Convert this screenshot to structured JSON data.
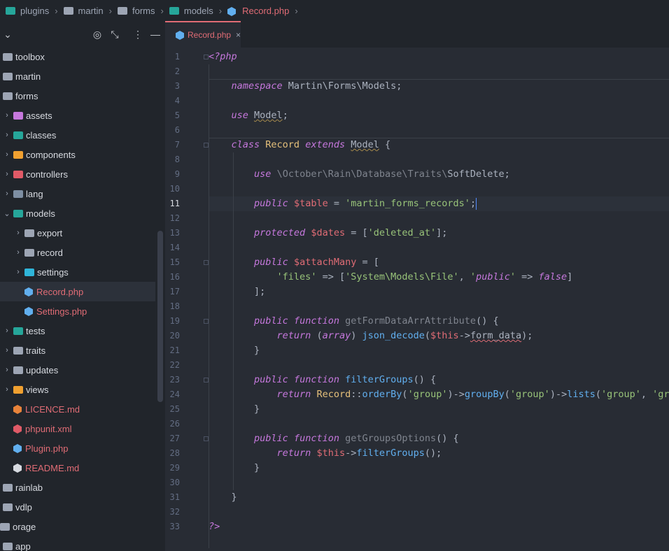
{
  "breadcrumb": [
    "plugins",
    "martin",
    "forms",
    "models",
    "Record.php"
  ],
  "tab": {
    "label": "Record.php",
    "close": "×"
  },
  "tree": [
    {
      "label": "toolbox",
      "indent": 0,
      "kind": "plain",
      "color": "#d7dae0"
    },
    {
      "label": "martin",
      "indent": 0,
      "kind": "plain",
      "color": "#d7dae0"
    },
    {
      "label": "forms",
      "indent": 0,
      "kind": "plain",
      "color": "#d7dae0"
    },
    {
      "label": "assets",
      "indent": 1,
      "kind": "folder",
      "icon": "#c678dd",
      "color": "#d7dae0"
    },
    {
      "label": "classes",
      "indent": 1,
      "kind": "folder",
      "icon": "#26a69a",
      "color": "#d7dae0"
    },
    {
      "label": "components",
      "indent": 1,
      "kind": "folder",
      "icon": "#f0a030",
      "color": "#d7dae0"
    },
    {
      "label": "controllers",
      "indent": 1,
      "kind": "folder",
      "icon": "#e05a67",
      "color": "#d7dae0"
    },
    {
      "label": "lang",
      "indent": 1,
      "kind": "folder",
      "icon": "#7e8fa3",
      "color": "#d7dae0"
    },
    {
      "label": "models",
      "indent": 1,
      "kind": "folder-open",
      "icon": "#26a69a",
      "color": "#d7dae0"
    },
    {
      "label": "export",
      "indent": 2,
      "kind": "folder",
      "icon": "#9da5b4",
      "color": "#d7dae0"
    },
    {
      "label": "record",
      "indent": 2,
      "kind": "folder",
      "icon": "#9da5b4",
      "color": "#d7dae0"
    },
    {
      "label": "settings",
      "indent": 2,
      "kind": "folder",
      "icon": "#2fb5d9",
      "color": "#d7dae0"
    },
    {
      "label": "Record.php",
      "indent": 2,
      "kind": "file",
      "icon": "#61afef",
      "color": "#e06c75",
      "selected": true
    },
    {
      "label": "Settings.php",
      "indent": 2,
      "kind": "file",
      "icon": "#61afef",
      "color": "#e06c75"
    },
    {
      "label": "tests",
      "indent": 1,
      "kind": "folder",
      "icon": "#26a69a",
      "color": "#d7dae0"
    },
    {
      "label": "traits",
      "indent": 1,
      "kind": "folder",
      "icon": "#9da5b4",
      "color": "#d7dae0"
    },
    {
      "label": "updates",
      "indent": 1,
      "kind": "folder",
      "icon": "#9da5b4",
      "color": "#d7dae0"
    },
    {
      "label": "views",
      "indent": 1,
      "kind": "folder",
      "icon": "#f0a030",
      "color": "#d7dae0"
    },
    {
      "label": "LICENCE.md",
      "indent": 1,
      "kind": "file",
      "icon": "#e8833a",
      "color": "#e06c75"
    },
    {
      "label": "phpunit.xml",
      "indent": 1,
      "kind": "file",
      "icon": "#e05a67",
      "color": "#e06c75"
    },
    {
      "label": "Plugin.php",
      "indent": 1,
      "kind": "file",
      "icon": "#61afef",
      "color": "#e06c75"
    },
    {
      "label": "README.md",
      "indent": 1,
      "kind": "file",
      "icon": "#d7dae0",
      "color": "#e06c75"
    },
    {
      "label": "rainlab",
      "indent": 0,
      "kind": "plain",
      "color": "#d7dae0"
    },
    {
      "label": "vdlp",
      "indent": 0,
      "kind": "plain",
      "color": "#d7dae0"
    },
    {
      "label": "orage",
      "indent": -1,
      "kind": "plain",
      "color": "#d7dae0"
    },
    {
      "label": "app",
      "indent": 0,
      "kind": "plain",
      "color": "#d7dae0"
    }
  ],
  "current_line": 11,
  "fold_lines": [
    1,
    7,
    15,
    19,
    23,
    27
  ],
  "code": [
    [
      [
        "kw",
        "<?php"
      ]
    ],
    [],
    [
      [
        "t",
        "    "
      ],
      [
        "kw",
        "namespace"
      ],
      [
        "t",
        " Martin\\Forms\\Models;"
      ]
    ],
    [],
    [
      [
        "t",
        "    "
      ],
      [
        "kw",
        "use"
      ],
      [
        "t",
        " "
      ],
      [
        "wv",
        "Model"
      ],
      [
        "t",
        ";"
      ]
    ],
    [],
    [
      [
        "t",
        "    "
      ],
      [
        "kw",
        "class"
      ],
      [
        "t",
        " "
      ],
      [
        "cls",
        "Record"
      ],
      [
        "t",
        " "
      ],
      [
        "kw",
        "extends"
      ],
      [
        "t",
        " "
      ],
      [
        "wv",
        "Model"
      ],
      [
        "t",
        " {"
      ]
    ],
    [],
    [
      [
        "t",
        "        "
      ],
      [
        "kw",
        "use"
      ],
      [
        "t",
        " "
      ],
      [
        "dim",
        "\\October\\Rain\\Database\\Traits\\"
      ],
      [
        "t",
        "SoftDelete;"
      ]
    ],
    [],
    [
      [
        "t",
        "        "
      ],
      [
        "kw",
        "public"
      ],
      [
        "t",
        " "
      ],
      [
        "var",
        "$table"
      ],
      [
        "t",
        " = "
      ],
      [
        "str",
        "'martin_forms_records'"
      ],
      [
        "t",
        ";"
      ],
      [
        "cursor",
        ""
      ]
    ],
    [],
    [
      [
        "t",
        "        "
      ],
      [
        "kw",
        "protected"
      ],
      [
        "t",
        " "
      ],
      [
        "var",
        "$dates"
      ],
      [
        "t",
        " = ["
      ],
      [
        "str",
        "'deleted_at'"
      ],
      [
        "t",
        "];"
      ]
    ],
    [],
    [
      [
        "t",
        "        "
      ],
      [
        "kw",
        "public"
      ],
      [
        "t",
        " "
      ],
      [
        "var",
        "$attachMany"
      ],
      [
        "t",
        " = ["
      ]
    ],
    [
      [
        "t",
        "            "
      ],
      [
        "str",
        "'files'"
      ],
      [
        "t",
        " => ["
      ],
      [
        "str",
        "'System\\Models\\File'"
      ],
      [
        "t",
        ", "
      ],
      [
        "str",
        "'"
      ],
      [
        "kw",
        "public"
      ],
      [
        "str",
        "'"
      ],
      [
        "t",
        " => "
      ],
      [
        "kw",
        "false"
      ],
      [
        "t",
        "]"
      ]
    ],
    [
      [
        "t",
        "        ];"
      ]
    ],
    [],
    [
      [
        "t",
        "        "
      ],
      [
        "kw",
        "public"
      ],
      [
        "t",
        " "
      ],
      [
        "kw",
        "function"
      ],
      [
        "t",
        " "
      ],
      [
        "dim",
        "getFormDataArrAttribute"
      ],
      [
        "t",
        "() {"
      ]
    ],
    [
      [
        "t",
        "            "
      ],
      [
        "kw",
        "return"
      ],
      [
        "t",
        " ("
      ],
      [
        "kw",
        "array"
      ],
      [
        "t",
        ") "
      ],
      [
        "fn",
        "json_decode"
      ],
      [
        "t",
        "("
      ],
      [
        "var",
        "$this"
      ],
      [
        "t",
        "->"
      ],
      [
        "wvr",
        "form_data"
      ],
      [
        "t",
        ");"
      ]
    ],
    [
      [
        "t",
        "        }"
      ]
    ],
    [],
    [
      [
        "t",
        "        "
      ],
      [
        "kw",
        "public"
      ],
      [
        "t",
        " "
      ],
      [
        "kw",
        "function"
      ],
      [
        "t",
        " "
      ],
      [
        "fn",
        "filterGroups"
      ],
      [
        "t",
        "() {"
      ]
    ],
    [
      [
        "t",
        "            "
      ],
      [
        "kw",
        "return"
      ],
      [
        "t",
        " "
      ],
      [
        "cls",
        "Record"
      ],
      [
        "t",
        "::"
      ],
      [
        "fn",
        "orderBy"
      ],
      [
        "t",
        "("
      ],
      [
        "str",
        "'group'"
      ],
      [
        "t",
        ")->"
      ],
      [
        "fn",
        "groupBy"
      ],
      [
        "t",
        "("
      ],
      [
        "str",
        "'group'"
      ],
      [
        "t",
        ")->"
      ],
      [
        "fn",
        "lists"
      ],
      [
        "t",
        "("
      ],
      [
        "str",
        "'group'"
      ],
      [
        "t",
        ", "
      ],
      [
        "str",
        "'gro"
      ]
    ],
    [
      [
        "t",
        "        }"
      ]
    ],
    [],
    [
      [
        "t",
        "        "
      ],
      [
        "kw",
        "public"
      ],
      [
        "t",
        " "
      ],
      [
        "kw",
        "function"
      ],
      [
        "t",
        " "
      ],
      [
        "dim",
        "getGroupsOptions"
      ],
      [
        "t",
        "() {"
      ]
    ],
    [
      [
        "t",
        "            "
      ],
      [
        "kw",
        "return"
      ],
      [
        "t",
        " "
      ],
      [
        "var",
        "$this"
      ],
      [
        "t",
        "->"
      ],
      [
        "fn",
        "filterGroups"
      ],
      [
        "t",
        "();"
      ]
    ],
    [
      [
        "t",
        "        }"
      ]
    ],
    [],
    [
      [
        "t",
        "    }"
      ]
    ],
    [],
    [
      [
        "kw",
        "?>"
      ]
    ]
  ]
}
